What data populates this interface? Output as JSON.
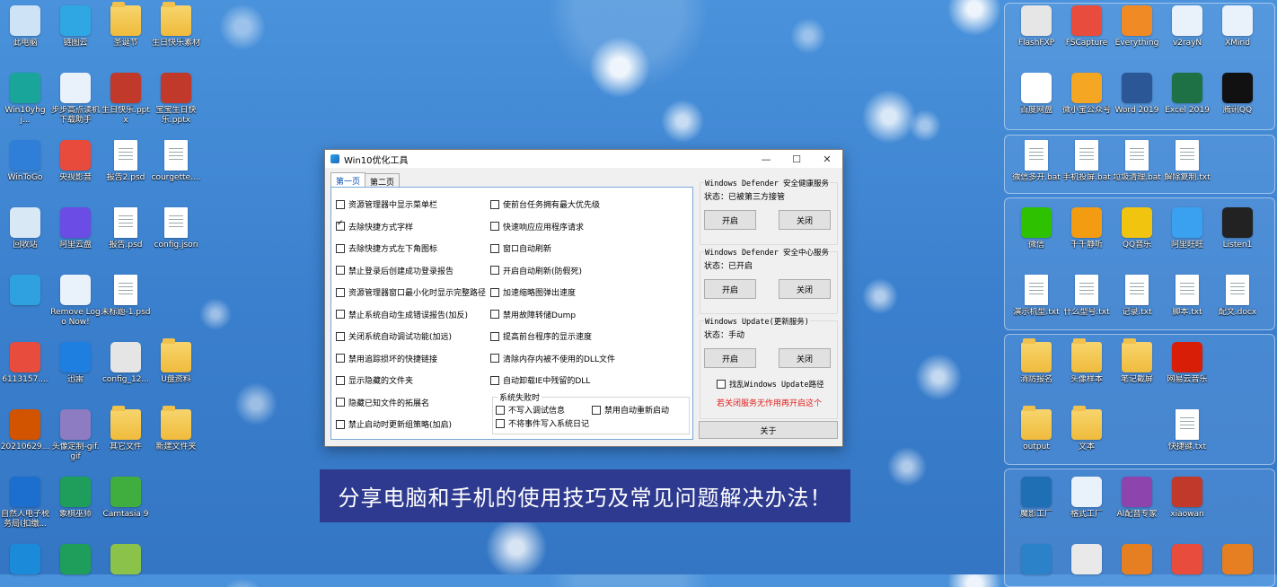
{
  "desktop_left": [
    {
      "label": "此电脑",
      "icon": "computer-icon",
      "color": "#cfe3f7"
    },
    {
      "label": "链图云",
      "icon": "cloud-app-icon",
      "color": "#2fa7e3"
    },
    {
      "label": "圣诞节",
      "icon": "folder-icon",
      "color": "#f0c24d"
    },
    {
      "label": "生日快乐素材",
      "icon": "folder-icon",
      "color": "#f0c24d"
    },
    {
      "label": "Win10yhgj...",
      "icon": "win10-tool-icon",
      "color": "#1aa59a"
    },
    {
      "label": "步步高点读机下载助手",
      "icon": "download-helper-icon",
      "color": "#e9f1fb"
    },
    {
      "label": "生日快乐.pptx",
      "icon": "pptx-icon",
      "color": "#c0392b"
    },
    {
      "label": "宝宝生日快乐.pptx",
      "icon": "pptx-icon",
      "color": "#c0392b"
    },
    {
      "label": "WinToGo",
      "icon": "wintogo-icon",
      "color": "#2f7fd8"
    },
    {
      "label": "央视影音",
      "icon": "cctv-player-icon",
      "color": "#e84a3c"
    },
    {
      "label": "报告2.psd",
      "icon": "document-icon",
      "color": "#ffffff"
    },
    {
      "label": "courgette....",
      "icon": "document-icon",
      "color": "#ffffff"
    },
    {
      "label": "回收站",
      "icon": "recycle-bin-icon",
      "color": "#d8e8f5"
    },
    {
      "label": "阿里云盘",
      "icon": "aliyun-drive-icon",
      "color": "#6b4de6"
    },
    {
      "label": "报告.psd",
      "icon": "document-icon",
      "color": "#ffffff"
    },
    {
      "label": "config.json",
      "icon": "json-file-icon",
      "color": "#ffffff"
    },
    {
      "label": "",
      "icon": "screen-tool-icon",
      "color": "#2fa1e0"
    },
    {
      "label": "Remove Logo Now!",
      "icon": "remove-logo-icon",
      "color": "#e9f1fb"
    },
    {
      "label": "未标题-1.psd",
      "icon": "document-icon",
      "color": "#ffffff"
    },
    {
      "label": "",
      "icon": "blank-icon",
      "color": "transparent"
    },
    {
      "label": "6113157....",
      "icon": "image-file-icon",
      "color": "#e74c3c"
    },
    {
      "label": "迅雷",
      "icon": "xunlei-icon",
      "color": "#1f7fe0"
    },
    {
      "label": "config_12...",
      "icon": "config-gear-icon",
      "color": "#e5e5e5"
    },
    {
      "label": "U盘资料",
      "icon": "folder-icon",
      "color": "#f0c24d"
    },
    {
      "label": "20210629...",
      "icon": "image-file-icon",
      "color": "#d35400"
    },
    {
      "label": "头像定制-gif.gif",
      "icon": "gif-file-icon",
      "color": "#8e7cc3"
    },
    {
      "label": "其它文件",
      "icon": "folder-icon",
      "color": "#f0c24d"
    },
    {
      "label": "新建文件夹",
      "icon": "folder-icon",
      "color": "#f0c24d"
    },
    {
      "label": "自然人电子税务局(扣缴...",
      "icon": "tax-app-icon",
      "color": "#1d6fcf"
    },
    {
      "label": "象棋巫师",
      "icon": "chess-icon",
      "color": "#1e9e5a"
    },
    {
      "label": "Camtasia 9",
      "icon": "camtasia-icon",
      "color": "#3fae3f"
    },
    {
      "label": "",
      "icon": "blank-icon",
      "color": "transparent"
    },
    {
      "label": "",
      "icon": "edge-icon",
      "color": "#1b8ad8"
    },
    {
      "label": "",
      "icon": "chess-icon",
      "color": "#1e9e5a"
    },
    {
      "label": "",
      "icon": "tool-icon",
      "color": "#8bc34a"
    }
  ],
  "desktop_right": [
    {
      "label": "FlashFXP",
      "icon": "flashfxp-icon",
      "color": "#e6e6e6"
    },
    {
      "label": "FSCapture",
      "icon": "fscapture-icon",
      "color": "#e74c3c"
    },
    {
      "label": "Everything",
      "icon": "everything-search-icon",
      "color": "#f08a24"
    },
    {
      "label": "v2rayN",
      "icon": "v2rayn-icon",
      "color": "#e9f1fb"
    },
    {
      "label": "XMind",
      "icon": "xmind-icon",
      "color": "#e9f1fb"
    },
    {
      "label": "百度网盘",
      "icon": "baidu-netdisk-icon",
      "color": "#ffffff"
    },
    {
      "label": "微小宝公众号",
      "icon": "weixiaobao-icon",
      "color": "#f5a623"
    },
    {
      "label": "Word 2019",
      "icon": "word-icon",
      "color": "#2b5797"
    },
    {
      "label": "Excel 2019",
      "icon": "excel-icon",
      "color": "#1e7145"
    },
    {
      "label": "腾讯QQ",
      "icon": "qq-icon",
      "color": "#111111"
    },
    {
      "label": "微信多开.bat",
      "icon": "bat-file-icon",
      "color": "#e5e5e5"
    },
    {
      "label": "手机投屏.bat",
      "icon": "bat-file-icon",
      "color": "#e5e5e5"
    },
    {
      "label": "垃圾清理.bat",
      "icon": "bat-file-icon",
      "color": "#e5e5e5"
    },
    {
      "label": "解除复制.txt",
      "icon": "txt-file-icon",
      "color": "#ffffff"
    },
    {
      "label": "",
      "icon": "blank-icon",
      "color": "transparent"
    },
    {
      "label": "微信",
      "icon": "wechat-icon",
      "color": "#2dc100"
    },
    {
      "label": "千千静听",
      "icon": "ttplayer-icon",
      "color": "#f39c12"
    },
    {
      "label": "QQ音乐",
      "icon": "qq-music-icon",
      "color": "#f1c40f"
    },
    {
      "label": "阿里旺旺",
      "icon": "aliwangwang-icon",
      "color": "#3aa0f0"
    },
    {
      "label": "Listen1",
      "icon": "listen1-icon",
      "color": "#222222"
    },
    {
      "label": "演示机型.txt",
      "icon": "txt-file-icon",
      "color": "#ffffff"
    },
    {
      "label": "什么型号.txt",
      "icon": "txt-file-icon",
      "color": "#ffffff"
    },
    {
      "label": "记录.txt",
      "icon": "txt-file-icon",
      "color": "#ffffff"
    },
    {
      "label": "脚本.txt",
      "icon": "txt-file-icon",
      "color": "#ffffff"
    },
    {
      "label": "配文.docx",
      "icon": "docx-file-icon",
      "color": "#ffffff"
    },
    {
      "label": "消防报名",
      "icon": "folder-icon",
      "color": "#f0c24d"
    },
    {
      "label": "头像样本",
      "icon": "folder-icon",
      "color": "#f0c24d"
    },
    {
      "label": "笔记截屏",
      "icon": "folder-icon",
      "color": "#f0c24d"
    },
    {
      "label": "网易云音乐",
      "icon": "netease-music-icon",
      "color": "#d81e06"
    },
    {
      "label": "",
      "icon": "blank-icon",
      "color": "transparent"
    },
    {
      "label": "output",
      "icon": "folder-icon",
      "color": "#f0c24d"
    },
    {
      "label": "文本",
      "icon": "folder-icon",
      "color": "#f0c24d"
    },
    {
      "label": "",
      "icon": "blank-icon",
      "color": "transparent"
    },
    {
      "label": "快捷键.txt",
      "icon": "txt-file-icon",
      "color": "#ffffff"
    },
    {
      "label": "",
      "icon": "blank-icon",
      "color": "transparent"
    },
    {
      "label": "魔影工厂",
      "icon": "moying-icon",
      "color": "#1f6fb5"
    },
    {
      "label": "格式工厂",
      "icon": "format-factory-icon",
      "color": "#e9f1fb"
    },
    {
      "label": "AI配音专家",
      "icon": "ai-voice-icon",
      "color": "#8e44ad"
    },
    {
      "label": "xiaowan",
      "icon": "xiaowan-icon",
      "color": "#c0392b"
    },
    {
      "label": "",
      "icon": "blank-icon",
      "color": "transparent"
    },
    {
      "label": "",
      "icon": "monitor-icon",
      "color": "#2c82c9"
    },
    {
      "label": "",
      "icon": "sg-icon",
      "color": "#e9e9e9"
    },
    {
      "label": "",
      "icon": "tool-icon",
      "color": "#e67e22"
    },
    {
      "label": "",
      "icon": "video-icon",
      "color": "#e74c3c"
    },
    {
      "label": "",
      "icon": "game-icon",
      "color": "#e67e22"
    }
  ],
  "window": {
    "title": "Win10优化工具",
    "controls": {
      "minimize": "—",
      "maximize": "☐",
      "close": "✕"
    },
    "tabs": [
      "第一页",
      "第二页"
    ],
    "left_options": [
      {
        "label": "资源管理器中显示菜单栏",
        "checked": false
      },
      {
        "label": "去除快捷方式字样",
        "checked": true
      },
      {
        "label": "去除快捷方式左下角图标",
        "checked": false
      },
      {
        "label": "禁止登录后创建成功登录报告",
        "checked": false
      },
      {
        "label": "资源管理器窗口最小化时显示完整路径",
        "checked": false
      },
      {
        "label": "禁止系统自动生成错误报告(加反)",
        "checked": false
      },
      {
        "label": "关闭系统自动调试功能(加远)",
        "checked": false
      },
      {
        "label": "禁用追踪损坏的快捷链接",
        "checked": false
      },
      {
        "label": "显示隐藏的文件夹",
        "checked": false
      },
      {
        "label": "隐藏已知文件的拓展名",
        "checked": false
      },
      {
        "label": "禁止启动时更新组策略(加启)",
        "checked": false
      }
    ],
    "right_options": [
      {
        "label": "使前台任务拥有最大优先级",
        "checked": false
      },
      {
        "label": "快速响应应用程序请求",
        "checked": false
      },
      {
        "label": "窗口自动刷新",
        "checked": false
      },
      {
        "label": "开启自动刷新(防假死)",
        "checked": false
      },
      {
        "label": "加速缩略图弹出速度",
        "checked": false
      },
      {
        "label": "禁用故障转储Dump",
        "checked": false
      },
      {
        "label": "提高前台程序的显示速度",
        "checked": false
      },
      {
        "label": "清除内存内被不使用的DLL文件",
        "checked": false
      },
      {
        "label": "自动卸载IE中残留的DLL",
        "checked": false
      }
    ],
    "failure_group": {
      "title": "系统失败时",
      "options": [
        {
          "label": "不写入调试信息",
          "checked": false
        },
        {
          "label": "禁用自动重新启动",
          "checked": false
        },
        {
          "label": "不将事件写入系统日记",
          "checked": false
        }
      ]
    },
    "services": [
      {
        "title": "Windows Defender 安全健康服务",
        "status": "状态：已被第三方接管",
        "on": "开启",
        "off": "关闭"
      },
      {
        "title": "Windows Defender 安全中心服务",
        "status": "状态：已开启",
        "on": "开启",
        "off": "关闭"
      },
      {
        "title": "Windows Update(更新服务)",
        "status": "状态：手动",
        "on": "开启",
        "off": "关闭"
      }
    ],
    "find_update_path": {
      "label": "找乱Windows Update路径",
      "checked": false
    },
    "warning": "若关闭服务无作用再开启这个",
    "warning_color": "#e0201c",
    "about": "关于"
  },
  "banner": {
    "text": "分享电脑和手机的使用技巧及常见问题解决办法！",
    "bg": "#2e3a8f"
  }
}
